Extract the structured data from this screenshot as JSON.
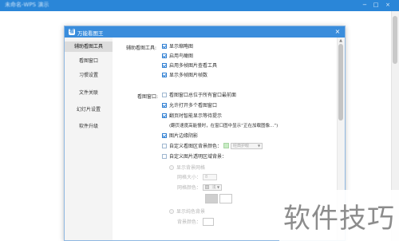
{
  "background_window": {
    "title": "未命名-WPS 演示",
    "controls": [
      "−",
      "□",
      "×"
    ]
  },
  "dialog": {
    "title": "万能看图王",
    "close_glyph": "×",
    "app_icon_glyph": "看",
    "accent_color": "#3a8ddc"
  },
  "nav": {
    "items": [
      {
        "label": "辅助看图工具",
        "active": true
      },
      {
        "label": "看图窗口",
        "active": false
      },
      {
        "label": "习惯设置",
        "active": false
      },
      {
        "label": "文件关联",
        "active": false
      },
      {
        "label": "幻灯片设置",
        "active": false
      },
      {
        "label": "软件升级",
        "active": false
      }
    ]
  },
  "aux_tools": {
    "label": "辅助看图工具:",
    "options": [
      {
        "label": "显示缩略图",
        "checked": true
      },
      {
        "label": "启用鸟瞰图",
        "checked": true
      },
      {
        "label": "启用多帧图片查看工具",
        "checked": true
      },
      {
        "label": "显示多帧图片帧数",
        "checked": true
      }
    ]
  },
  "view_window": {
    "label": "看图窗口:",
    "options": [
      {
        "label": "看图窗口总位于所有窗口最前面",
        "checked": false
      },
      {
        "label": "允许打开多个看图窗口",
        "checked": true
      },
      {
        "label": "翻页时智能显示等待提示",
        "checked": true
      }
    ],
    "note": "(翻页速度高能慢时，在窗口图中显示“正在加载图像...”)",
    "more_options": [
      {
        "label": "图片边缘阴影",
        "checked": true
      },
      {
        "label": "自定义看图区背景颜色：",
        "checked": false
      },
      {
        "label": "自定义图片透明区域背景：",
        "checked": false
      }
    ],
    "bg_color_select": "经典护眼",
    "grid_section": {
      "radio_label": "显示背景网格",
      "size_label": "网格大小：",
      "size_value": "8",
      "color_label": "网格颜色：",
      "color_value": "浅"
    },
    "solid_section": {
      "radio_label": "显示纯色背景",
      "color_label": "背景颜色："
    }
  },
  "watermark": "软件技巧"
}
